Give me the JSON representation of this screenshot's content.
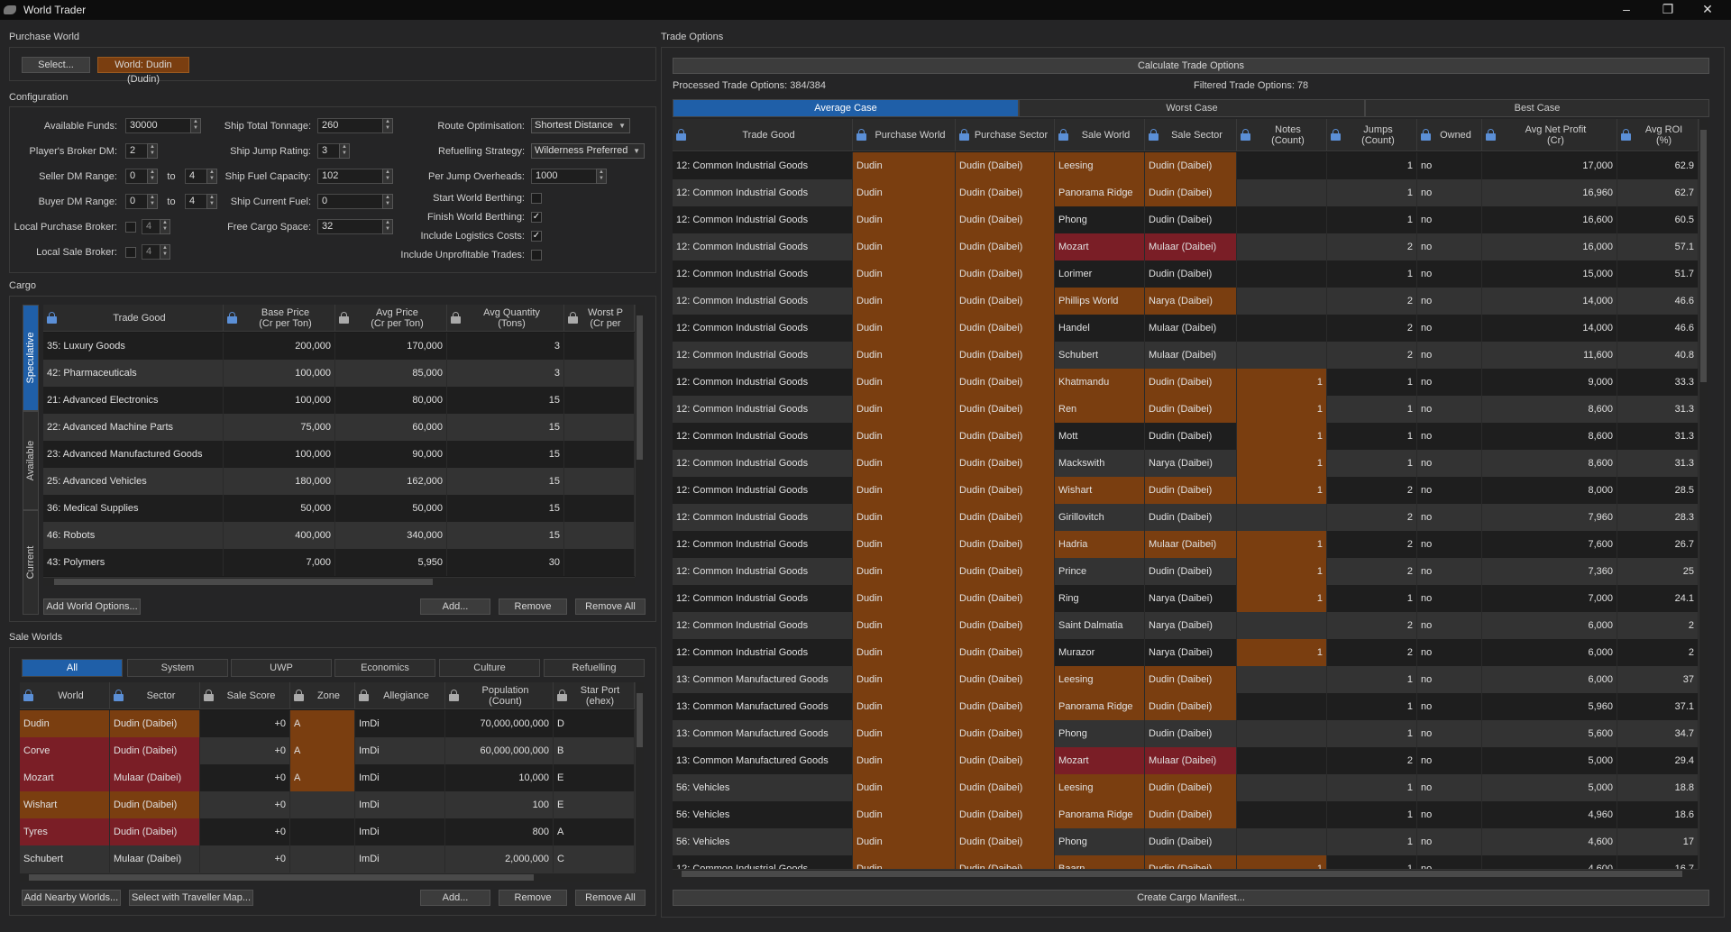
{
  "window": {
    "title": "World Trader"
  },
  "purchase_world": {
    "section": "Purchase World",
    "select_button": "Select...",
    "world_label": "World: Dudin (Dudin)"
  },
  "configuration": {
    "section": "Configuration",
    "available_funds": {
      "label": "Available Funds:",
      "value": "30000"
    },
    "broker_dm": {
      "label": "Player's Broker DM:",
      "value": "2"
    },
    "seller_dm": {
      "label": "Seller DM Range:",
      "min": "0",
      "to": "to",
      "max": "4"
    },
    "buyer_dm": {
      "label": "Buyer DM Range:",
      "min": "0",
      "to": "to",
      "max": "4"
    },
    "local_purchase_broker": {
      "label": "Local Purchase Broker:",
      "value": "4"
    },
    "local_sale_broker": {
      "label": "Local Sale Broker:",
      "value": "4"
    },
    "ship_tonnage": {
      "label": "Ship Total Tonnage:",
      "value": "260"
    },
    "jump_rating": {
      "label": "Ship Jump Rating:",
      "value": "3"
    },
    "fuel_capacity": {
      "label": "Ship Fuel Capacity:",
      "value": "102"
    },
    "current_fuel": {
      "label": "Ship Current Fuel:",
      "value": "0"
    },
    "free_cargo": {
      "label": "Free Cargo Space:",
      "value": "32"
    },
    "route_opt": {
      "label": "Route Optimisation:",
      "value": "Shortest Distance"
    },
    "refuelling": {
      "label": "Refuelling Strategy:",
      "value": "Wilderness Preferred"
    },
    "per_jump": {
      "label": "Per Jump Overheads:",
      "value": "1000"
    },
    "start_berthing": {
      "label": "Start World Berthing:",
      "checked": ""
    },
    "finish_berthing": {
      "label": "Finish World Berthing:",
      "checked": "✓"
    },
    "logistics": {
      "label": "Include Logistics Costs:",
      "checked": "✓"
    },
    "unprofitable": {
      "label": "Include Unprofitable Trades:",
      "checked": ""
    }
  },
  "cargo": {
    "section": "Cargo",
    "vtabs": [
      "Speculative",
      "Available",
      "Current"
    ],
    "headers": [
      "Trade Good",
      "Base Price\n(Cr per Ton)",
      "Avg Price\n(Cr per Ton)",
      "Avg Quantity\n(Tons)",
      "Worst P\n(Cr per"
    ],
    "rows": [
      [
        "35: Luxury Goods",
        "200,000",
        "170,000",
        "3"
      ],
      [
        "42: Pharmaceuticals",
        "100,000",
        "85,000",
        "3"
      ],
      [
        "21: Advanced Electronics",
        "100,000",
        "80,000",
        "15"
      ],
      [
        "22: Advanced Machine Parts",
        "75,000",
        "60,000",
        "15"
      ],
      [
        "23: Advanced Manufactured Goods",
        "100,000",
        "90,000",
        "15"
      ],
      [
        "25: Advanced Vehicles",
        "180,000",
        "162,000",
        "15"
      ],
      [
        "36: Medical Supplies",
        "50,000",
        "50,000",
        "15"
      ],
      [
        "46: Robots",
        "400,000",
        "340,000",
        "15"
      ],
      [
        "43: Polymers",
        "7,000",
        "5,950",
        "30"
      ]
    ],
    "add_world_options": "Add World Options...",
    "add": "Add...",
    "remove": "Remove",
    "remove_all": "Remove All"
  },
  "sale_worlds": {
    "section": "Sale Worlds",
    "tabs": [
      "All",
      "System",
      "UWP",
      "Economics",
      "Culture",
      "Refuelling"
    ],
    "headers": [
      "World",
      "Sector",
      "Sale Score",
      "Zone",
      "Allegiance",
      "Population\n(Count)",
      "Star Port\n(ehex)"
    ],
    "rows": [
      {
        "c": [
          "Dudin",
          "Dudin (Daibei)",
          "+0",
          "A",
          "ImDi",
          "70,000,000,000",
          "D"
        ],
        "style": "orange"
      },
      {
        "c": [
          "Corve",
          "Dudin (Daibei)",
          "+0",
          "A",
          "ImDi",
          "60,000,000,000",
          "B"
        ],
        "style": "red"
      },
      {
        "c": [
          "Mozart",
          "Mulaar (Daibei)",
          "+0",
          "A",
          "ImDi",
          "10,000",
          "E"
        ],
        "style": "red"
      },
      {
        "c": [
          "Wishart",
          "Dudin (Daibei)",
          "+0",
          "",
          "ImDi",
          "100",
          "E"
        ],
        "style": "orange"
      },
      {
        "c": [
          "Tyres",
          "Dudin (Daibei)",
          "+0",
          "",
          "ImDi",
          "800",
          "A"
        ],
        "style": "red"
      },
      {
        "c": [
          "Schubert",
          "Mulaar (Daibei)",
          "+0",
          "",
          "ImDi",
          "2,000,000",
          "C"
        ],
        "style": "none"
      }
    ],
    "add_nearby": "Add Nearby Worlds...",
    "select_map": "Select with Traveller Map...",
    "add": "Add...",
    "remove": "Remove",
    "remove_all": "Remove All"
  },
  "trade_options": {
    "section": "Trade Options",
    "calculate": "Calculate Trade Options",
    "processed": "Processed Trade Options: 384/384",
    "filtered": "Filtered Trade Options: 78",
    "tabs": [
      "Average Case",
      "Worst Case",
      "Best Case"
    ],
    "headers": [
      "Trade Good",
      "Purchase World",
      "Purchase Sector",
      "Sale World",
      "Sale Sector",
      "Notes\n(Count)",
      "Jumps\n(Count)",
      "Owned",
      "Avg Net Profit\n(Cr)",
      "Avg ROI\n(%)"
    ],
    "rows": [
      [
        "12: Common Industrial Goods",
        "Dudin",
        "Dudin (Daibei)",
        "Leesing",
        "Dudin (Daibei)",
        "",
        "1",
        "no",
        "17,000",
        "62.9",
        "o",
        "o"
      ],
      [
        "12: Common Industrial Goods",
        "Dudin",
        "Dudin (Daibei)",
        "Panorama Ridge",
        "Dudin (Daibei)",
        "",
        "1",
        "no",
        "16,960",
        "62.7",
        "o",
        "o"
      ],
      [
        "12: Common Industrial Goods",
        "Dudin",
        "Dudin (Daibei)",
        "Phong",
        "Dudin (Daibei)",
        "",
        "1",
        "no",
        "16,600",
        "60.5",
        "o",
        "n"
      ],
      [
        "12: Common Industrial Goods",
        "Dudin",
        "Dudin (Daibei)",
        "Mozart",
        "Mulaar (Daibei)",
        "",
        "2",
        "no",
        "16,000",
        "57.1",
        "o",
        "r"
      ],
      [
        "12: Common Industrial Goods",
        "Dudin",
        "Dudin (Daibei)",
        "Lorimer",
        "Dudin (Daibei)",
        "",
        "1",
        "no",
        "15,000",
        "51.7",
        "o",
        "n"
      ],
      [
        "12: Common Industrial Goods",
        "Dudin",
        "Dudin (Daibei)",
        "Phillips World",
        "Narya (Daibei)",
        "",
        "2",
        "no",
        "14,000",
        "46.6",
        "o",
        "o"
      ],
      [
        "12: Common Industrial Goods",
        "Dudin",
        "Dudin (Daibei)",
        "Handel",
        "Mulaar (Daibei)",
        "",
        "2",
        "no",
        "14,000",
        "46.6",
        "o",
        "n"
      ],
      [
        "12: Common Industrial Goods",
        "Dudin",
        "Dudin (Daibei)",
        "Schubert",
        "Mulaar (Daibei)",
        "",
        "2",
        "no",
        "11,600",
        "40.8",
        "o",
        "n"
      ],
      [
        "12: Common Industrial Goods",
        "Dudin",
        "Dudin (Daibei)",
        "Khatmandu",
        "Dudin (Daibei)",
        "1",
        "1",
        "no",
        "9,000",
        "33.3",
        "o",
        "o"
      ],
      [
        "12: Common Industrial Goods",
        "Dudin",
        "Dudin (Daibei)",
        "Ren",
        "Dudin (Daibei)",
        "1",
        "1",
        "no",
        "8,600",
        "31.3",
        "o",
        "o"
      ],
      [
        "12: Common Industrial Goods",
        "Dudin",
        "Dudin (Daibei)",
        "Mott",
        "Dudin (Daibei)",
        "1",
        "1",
        "no",
        "8,600",
        "31.3",
        "o",
        "n"
      ],
      [
        "12: Common Industrial Goods",
        "Dudin",
        "Dudin (Daibei)",
        "Mackswith",
        "Narya (Daibei)",
        "1",
        "1",
        "no",
        "8,600",
        "31.3",
        "o",
        "n"
      ],
      [
        "12: Common Industrial Goods",
        "Dudin",
        "Dudin (Daibei)",
        "Wishart",
        "Dudin (Daibei)",
        "1",
        "2",
        "no",
        "8,000",
        "28.5",
        "o",
        "o"
      ],
      [
        "12: Common Industrial Goods",
        "Dudin",
        "Dudin (Daibei)",
        "Girillovitch",
        "Dudin (Daibei)",
        "",
        "2",
        "no",
        "7,960",
        "28.3",
        "o",
        "n"
      ],
      [
        "12: Common Industrial Goods",
        "Dudin",
        "Dudin (Daibei)",
        "Hadria",
        "Mulaar (Daibei)",
        "1",
        "2",
        "no",
        "7,600",
        "26.7",
        "o",
        "o"
      ],
      [
        "12: Common Industrial Goods",
        "Dudin",
        "Dudin (Daibei)",
        "Prince",
        "Dudin (Daibei)",
        "1",
        "2",
        "no",
        "7,360",
        "25",
        "o",
        "n"
      ],
      [
        "12: Common Industrial Goods",
        "Dudin",
        "Dudin (Daibei)",
        "Ring",
        "Narya (Daibei)",
        "1",
        "1",
        "no",
        "7,000",
        "24.1",
        "o",
        "n"
      ],
      [
        "12: Common Industrial Goods",
        "Dudin",
        "Dudin (Daibei)",
        "Saint Dalmatia",
        "Narya (Daibei)",
        "",
        "2",
        "no",
        "6,000",
        "2",
        "o",
        "n"
      ],
      [
        "12: Common Industrial Goods",
        "Dudin",
        "Dudin (Daibei)",
        "Murazor",
        "Narya (Daibei)",
        "1",
        "2",
        "no",
        "6,000",
        "2",
        "o",
        "n"
      ],
      [
        "13: Common Manufactured Goods",
        "Dudin",
        "Dudin (Daibei)",
        "Leesing",
        "Dudin (Daibei)",
        "",
        "1",
        "no",
        "6,000",
        "37",
        "o",
        "o"
      ],
      [
        "13: Common Manufactured Goods",
        "Dudin",
        "Dudin (Daibei)",
        "Panorama Ridge",
        "Dudin (Daibei)",
        "",
        "1",
        "no",
        "5,960",
        "37.1",
        "o",
        "o"
      ],
      [
        "13: Common Manufactured Goods",
        "Dudin",
        "Dudin (Daibei)",
        "Phong",
        "Dudin (Daibei)",
        "",
        "1",
        "no",
        "5,600",
        "34.7",
        "o",
        "n"
      ],
      [
        "13: Common Manufactured Goods",
        "Dudin",
        "Dudin (Daibei)",
        "Mozart",
        "Mulaar (Daibei)",
        "",
        "2",
        "no",
        "5,000",
        "29.4",
        "o",
        "r"
      ],
      [
        "56: Vehicles",
        "Dudin",
        "Dudin (Daibei)",
        "Leesing",
        "Dudin (Daibei)",
        "",
        "1",
        "no",
        "5,000",
        "18.8",
        "o",
        "o"
      ],
      [
        "56: Vehicles",
        "Dudin",
        "Dudin (Daibei)",
        "Panorama Ridge",
        "Dudin (Daibei)",
        "",
        "1",
        "no",
        "4,960",
        "18.6",
        "o",
        "o"
      ],
      [
        "56: Vehicles",
        "Dudin",
        "Dudin (Daibei)",
        "Phong",
        "Dudin (Daibei)",
        "",
        "1",
        "no",
        "4,600",
        "17",
        "o",
        "n"
      ],
      [
        "12: Common Industrial Goods",
        "Dudin",
        "Dudin (Daibei)",
        "Baarn",
        "Dudin (Daibei)",
        "1",
        "1",
        "no",
        "4,600",
        "16.7",
        "o",
        "o"
      ]
    ],
    "create_manifest": "Create Cargo Manifest..."
  },
  "colors": {
    "accent": "#1f5fa8",
    "orange": "#7a3e10",
    "red": "#7a1e26"
  }
}
